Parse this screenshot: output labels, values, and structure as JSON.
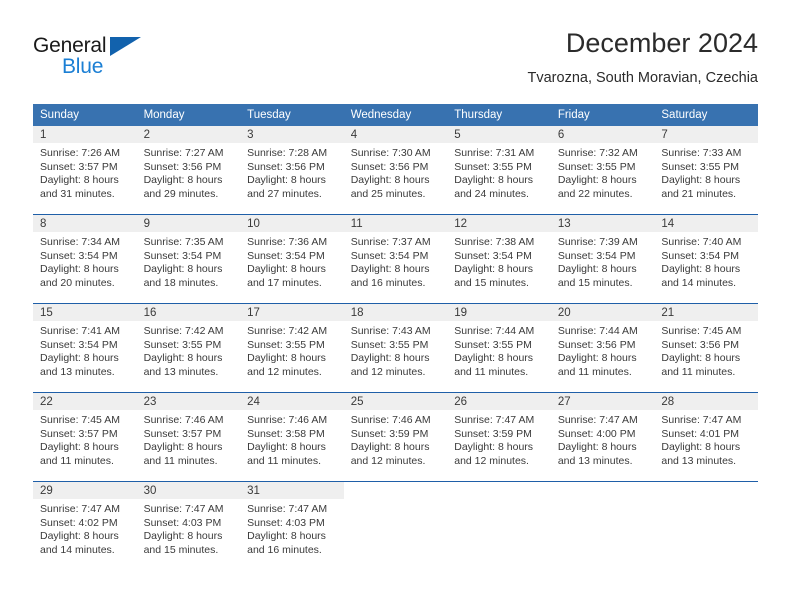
{
  "brand": {
    "name_part1": "General",
    "name_part2": "Blue",
    "triangle_icon": "triangle-icon",
    "color_dark": "#1a1a1a",
    "color_blue": "#1b7fd4",
    "triangle_color": "#1262ad"
  },
  "header": {
    "title": "December 2024",
    "subtitle": "Tvarozna, South Moravian, Czechia"
  },
  "colors": {
    "header_blue": "#3872b0",
    "row_separator_blue": "#1f5fa8",
    "daynum_band": "#efefef",
    "text": "#3a3a3a"
  },
  "calendar": {
    "weekday_headers": [
      "Sunday",
      "Monday",
      "Tuesday",
      "Wednesday",
      "Thursday",
      "Friday",
      "Saturday"
    ],
    "weeks": [
      [
        {
          "day": "1",
          "sunrise": "Sunrise: 7:26 AM",
          "sunset": "Sunset: 3:57 PM",
          "daylight1": "Daylight: 8 hours",
          "daylight2": "and 31 minutes."
        },
        {
          "day": "2",
          "sunrise": "Sunrise: 7:27 AM",
          "sunset": "Sunset: 3:56 PM",
          "daylight1": "Daylight: 8 hours",
          "daylight2": "and 29 minutes."
        },
        {
          "day": "3",
          "sunrise": "Sunrise: 7:28 AM",
          "sunset": "Sunset: 3:56 PM",
          "daylight1": "Daylight: 8 hours",
          "daylight2": "and 27 minutes."
        },
        {
          "day": "4",
          "sunrise": "Sunrise: 7:30 AM",
          "sunset": "Sunset: 3:56 PM",
          "daylight1": "Daylight: 8 hours",
          "daylight2": "and 25 minutes."
        },
        {
          "day": "5",
          "sunrise": "Sunrise: 7:31 AM",
          "sunset": "Sunset: 3:55 PM",
          "daylight1": "Daylight: 8 hours",
          "daylight2": "and 24 minutes."
        },
        {
          "day": "6",
          "sunrise": "Sunrise: 7:32 AM",
          "sunset": "Sunset: 3:55 PM",
          "daylight1": "Daylight: 8 hours",
          "daylight2": "and 22 minutes."
        },
        {
          "day": "7",
          "sunrise": "Sunrise: 7:33 AM",
          "sunset": "Sunset: 3:55 PM",
          "daylight1": "Daylight: 8 hours",
          "daylight2": "and 21 minutes."
        }
      ],
      [
        {
          "day": "8",
          "sunrise": "Sunrise: 7:34 AM",
          "sunset": "Sunset: 3:54 PM",
          "daylight1": "Daylight: 8 hours",
          "daylight2": "and 20 minutes."
        },
        {
          "day": "9",
          "sunrise": "Sunrise: 7:35 AM",
          "sunset": "Sunset: 3:54 PM",
          "daylight1": "Daylight: 8 hours",
          "daylight2": "and 18 minutes."
        },
        {
          "day": "10",
          "sunrise": "Sunrise: 7:36 AM",
          "sunset": "Sunset: 3:54 PM",
          "daylight1": "Daylight: 8 hours",
          "daylight2": "and 17 minutes."
        },
        {
          "day": "11",
          "sunrise": "Sunrise: 7:37 AM",
          "sunset": "Sunset: 3:54 PM",
          "daylight1": "Daylight: 8 hours",
          "daylight2": "and 16 minutes."
        },
        {
          "day": "12",
          "sunrise": "Sunrise: 7:38 AM",
          "sunset": "Sunset: 3:54 PM",
          "daylight1": "Daylight: 8 hours",
          "daylight2": "and 15 minutes."
        },
        {
          "day": "13",
          "sunrise": "Sunrise: 7:39 AM",
          "sunset": "Sunset: 3:54 PM",
          "daylight1": "Daylight: 8 hours",
          "daylight2": "and 15 minutes."
        },
        {
          "day": "14",
          "sunrise": "Sunrise: 7:40 AM",
          "sunset": "Sunset: 3:54 PM",
          "daylight1": "Daylight: 8 hours",
          "daylight2": "and 14 minutes."
        }
      ],
      [
        {
          "day": "15",
          "sunrise": "Sunrise: 7:41 AM",
          "sunset": "Sunset: 3:54 PM",
          "daylight1": "Daylight: 8 hours",
          "daylight2": "and 13 minutes."
        },
        {
          "day": "16",
          "sunrise": "Sunrise: 7:42 AM",
          "sunset": "Sunset: 3:55 PM",
          "daylight1": "Daylight: 8 hours",
          "daylight2": "and 13 minutes."
        },
        {
          "day": "17",
          "sunrise": "Sunrise: 7:42 AM",
          "sunset": "Sunset: 3:55 PM",
          "daylight1": "Daylight: 8 hours",
          "daylight2": "and 12 minutes."
        },
        {
          "day": "18",
          "sunrise": "Sunrise: 7:43 AM",
          "sunset": "Sunset: 3:55 PM",
          "daylight1": "Daylight: 8 hours",
          "daylight2": "and 12 minutes."
        },
        {
          "day": "19",
          "sunrise": "Sunrise: 7:44 AM",
          "sunset": "Sunset: 3:55 PM",
          "daylight1": "Daylight: 8 hours",
          "daylight2": "and 11 minutes."
        },
        {
          "day": "20",
          "sunrise": "Sunrise: 7:44 AM",
          "sunset": "Sunset: 3:56 PM",
          "daylight1": "Daylight: 8 hours",
          "daylight2": "and 11 minutes."
        },
        {
          "day": "21",
          "sunrise": "Sunrise: 7:45 AM",
          "sunset": "Sunset: 3:56 PM",
          "daylight1": "Daylight: 8 hours",
          "daylight2": "and 11 minutes."
        }
      ],
      [
        {
          "day": "22",
          "sunrise": "Sunrise: 7:45 AM",
          "sunset": "Sunset: 3:57 PM",
          "daylight1": "Daylight: 8 hours",
          "daylight2": "and 11 minutes."
        },
        {
          "day": "23",
          "sunrise": "Sunrise: 7:46 AM",
          "sunset": "Sunset: 3:57 PM",
          "daylight1": "Daylight: 8 hours",
          "daylight2": "and 11 minutes."
        },
        {
          "day": "24",
          "sunrise": "Sunrise: 7:46 AM",
          "sunset": "Sunset: 3:58 PM",
          "daylight1": "Daylight: 8 hours",
          "daylight2": "and 11 minutes."
        },
        {
          "day": "25",
          "sunrise": "Sunrise: 7:46 AM",
          "sunset": "Sunset: 3:59 PM",
          "daylight1": "Daylight: 8 hours",
          "daylight2": "and 12 minutes."
        },
        {
          "day": "26",
          "sunrise": "Sunrise: 7:47 AM",
          "sunset": "Sunset: 3:59 PM",
          "daylight1": "Daylight: 8 hours",
          "daylight2": "and 12 minutes."
        },
        {
          "day": "27",
          "sunrise": "Sunrise: 7:47 AM",
          "sunset": "Sunset: 4:00 PM",
          "daylight1": "Daylight: 8 hours",
          "daylight2": "and 13 minutes."
        },
        {
          "day": "28",
          "sunrise": "Sunrise: 7:47 AM",
          "sunset": "Sunset: 4:01 PM",
          "daylight1": "Daylight: 8 hours",
          "daylight2": "and 13 minutes."
        }
      ],
      [
        {
          "day": "29",
          "sunrise": "Sunrise: 7:47 AM",
          "sunset": "Sunset: 4:02 PM",
          "daylight1": "Daylight: 8 hours",
          "daylight2": "and 14 minutes."
        },
        {
          "day": "30",
          "sunrise": "Sunrise: 7:47 AM",
          "sunset": "Sunset: 4:03 PM",
          "daylight1": "Daylight: 8 hours",
          "daylight2": "and 15 minutes."
        },
        {
          "day": "31",
          "sunrise": "Sunrise: 7:47 AM",
          "sunset": "Sunset: 4:03 PM",
          "daylight1": "Daylight: 8 hours",
          "daylight2": "and 16 minutes."
        },
        {
          "day": "",
          "sunrise": "",
          "sunset": "",
          "daylight1": "",
          "daylight2": ""
        },
        {
          "day": "",
          "sunrise": "",
          "sunset": "",
          "daylight1": "",
          "daylight2": ""
        },
        {
          "day": "",
          "sunrise": "",
          "sunset": "",
          "daylight1": "",
          "daylight2": ""
        },
        {
          "day": "",
          "sunrise": "",
          "sunset": "",
          "daylight1": "",
          "daylight2": ""
        }
      ]
    ]
  }
}
